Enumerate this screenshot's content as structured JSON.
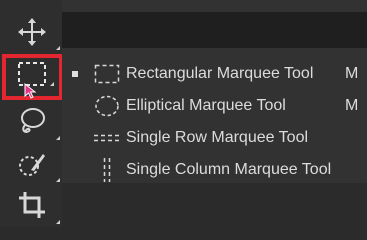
{
  "toolbar": {
    "tools": [
      {
        "name": "move",
        "icon": "move-icon"
      },
      {
        "name": "marquee",
        "icon": "rectangular-marquee-icon",
        "selected": true
      },
      {
        "name": "lasso",
        "icon": "lasso-icon"
      },
      {
        "name": "quick-selection",
        "icon": "quick-selection-icon"
      },
      {
        "name": "crop",
        "icon": "crop-icon"
      }
    ]
  },
  "flyout": {
    "items": [
      {
        "label": "Rectangular Marquee Tool",
        "shortcut": "M",
        "active": true,
        "icon": "rectangular-marquee-icon"
      },
      {
        "label": "Elliptical Marquee Tool",
        "shortcut": "M",
        "active": false,
        "icon": "elliptical-marquee-icon"
      },
      {
        "label": "Single Row Marquee Tool",
        "shortcut": "",
        "active": false,
        "icon": "single-row-marquee-icon"
      },
      {
        "label": "Single Column Marquee Tool",
        "shortcut": "",
        "active": false,
        "icon": "single-column-marquee-icon"
      }
    ]
  },
  "colors": {
    "highlight": "#e3262f",
    "cursor": "#e8338a",
    "text": "#dcdcdc"
  }
}
